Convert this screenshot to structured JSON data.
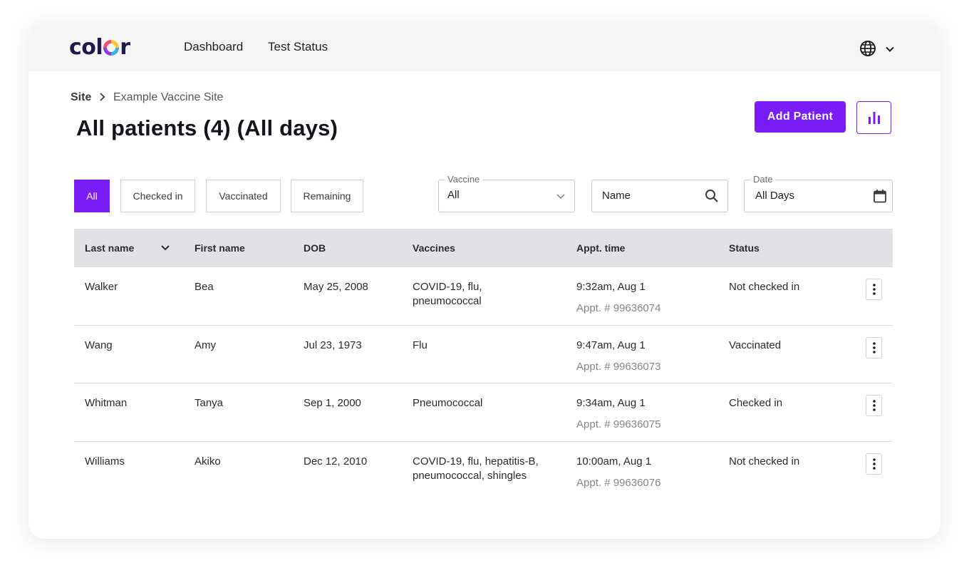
{
  "brand": {
    "logo_text_left": "col",
    "logo_text_right": "r"
  },
  "nav": {
    "items": [
      {
        "label": "Dashboard"
      },
      {
        "label": "Test Status"
      }
    ]
  },
  "breadcrumb": {
    "site": "Site",
    "current": "Example Vaccine Site"
  },
  "page": {
    "title": "All patients (4) (All days)"
  },
  "actions": {
    "add_patient_label": "Add Patient"
  },
  "filters": {
    "status_tabs": [
      {
        "label": "All"
      },
      {
        "label": "Checked in"
      },
      {
        "label": "Vaccinated"
      },
      {
        "label": "Remaining"
      }
    ],
    "vaccine": {
      "legend": "Vaccine",
      "value": "All"
    },
    "name_search": {
      "placeholder": "Name"
    },
    "date": {
      "legend": "Date",
      "value": "All Days"
    }
  },
  "table": {
    "columns": [
      "Last name",
      "First name",
      "DOB",
      "Vaccines",
      "Appt. time",
      "Status"
    ],
    "rows": [
      {
        "last": "Walker",
        "first": "Bea",
        "dob": "May 25, 2008",
        "vaccines_line1": "COVID-19, flu,",
        "vaccines_line2": "pneumococcal",
        "time": "9:32am, Aug 1",
        "appt": "Appt. # 99636074",
        "status": "Not checked in"
      },
      {
        "last": "Wang",
        "first": "Amy",
        "dob": "Jul 23, 1973",
        "vaccines_line1": "Flu",
        "vaccines_line2": "",
        "time": "9:47am, Aug 1",
        "appt": "Appt. # 99636073",
        "status": "Vaccinated"
      },
      {
        "last": "Whitman",
        "first": "Tanya",
        "dob": "Sep 1, 2000",
        "vaccines_line1": "Pneumococcal",
        "vaccines_line2": "",
        "time": "9:34am, Aug 1",
        "appt": "Appt. # 99636075",
        "status": "Checked in"
      },
      {
        "last": "Williams",
        "first": "Akiko",
        "dob": "Dec 12, 2010",
        "vaccines_line1": "COVID-19, flu, hepatitis-B,",
        "vaccines_line2": "pneumococcal, shingles",
        "time": "10:00am, Aug 1",
        "appt": "Appt. # 99636076",
        "status": "Not checked in"
      }
    ]
  },
  "colors": {
    "accent": "#7a1cf5",
    "header_bg": "#e2e2e6",
    "topbar_bg": "#f5f5f6"
  }
}
